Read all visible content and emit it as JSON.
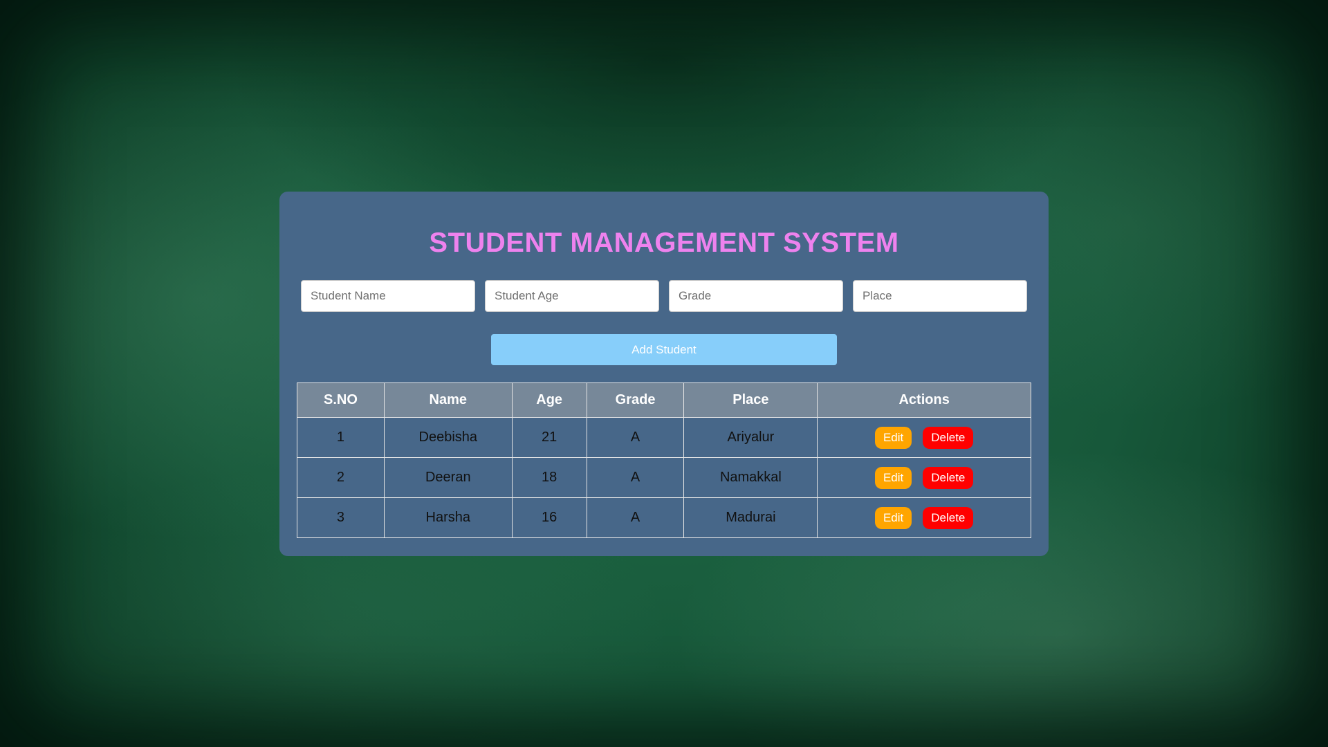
{
  "app": {
    "title": "STUDENT MANAGEMENT SYSTEM"
  },
  "form": {
    "name_placeholder": "Student Name",
    "age_placeholder": "Student Age",
    "grade_placeholder": "Grade",
    "place_placeholder": "Place",
    "add_label": "Add Student"
  },
  "table": {
    "headers": [
      "S.NO",
      "Name",
      "Age",
      "Grade",
      "Place",
      "Actions"
    ],
    "rows": [
      {
        "sno": "1",
        "name": "Deebisha",
        "age": "21",
        "grade": "A",
        "place": "Ariyalur",
        "edit": "Edit",
        "delete": "Delete"
      },
      {
        "sno": "2",
        "name": "Deeran",
        "age": "18",
        "grade": "A",
        "place": "Namakkal",
        "edit": "Edit",
        "delete": "Delete"
      },
      {
        "sno": "3",
        "name": "Harsha",
        "age": "16",
        "grade": "A",
        "place": "Madurai",
        "edit": "Edit",
        "delete": "Delete"
      }
    ]
  },
  "colors": {
    "background": "#1f6a45",
    "panel": "#476789",
    "title": "#ee82ee",
    "add_button": "#87cefa",
    "table_header": "#778899",
    "edit_button": "#ffa500",
    "delete_button": "#ff0000"
  }
}
